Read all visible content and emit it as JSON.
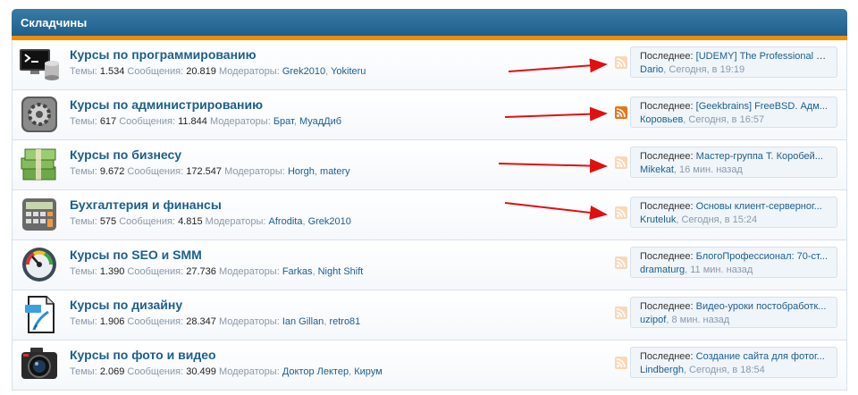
{
  "section": {
    "title": "Складчины"
  },
  "labels": {
    "topics": "Темы:",
    "messages": "Сообщения:",
    "moderators": "Модераторы:",
    "last": "Последнее:"
  },
  "nodes": [
    {
      "title": "Курсы по программированию",
      "icon": "terminal-icon",
      "topics": "1.534",
      "messages": "20.819",
      "mods": [
        "Grek2010",
        "Yokiteru"
      ],
      "last_thread": "[UDEMY] The Professional R...",
      "last_user": "Dario",
      "last_time": ", Сегодня, в 19:19",
      "rss_active": false
    },
    {
      "title": "Курсы по администрированию",
      "icon": "gear-icon",
      "topics": "617",
      "messages": "11.844",
      "mods": [
        "Брат",
        "МуадДиб"
      ],
      "last_thread": "[Geekbrains] FreeBSD. Адм...",
      "last_user": "Коровьев",
      "last_time": ", Сегодня, в 16:57",
      "rss_active": true
    },
    {
      "title": "Курсы по бизнесу",
      "icon": "money-icon",
      "topics": "9.672",
      "messages": "172.547",
      "mods": [
        "Horgh",
        "matery"
      ],
      "last_thread": "Мастер-группа Т. Коробей...",
      "last_user": "Mikekat",
      "last_time": ", 16 мин. назад",
      "rss_active": false
    },
    {
      "title": "Бухгалтерия и финансы",
      "icon": "calculator-icon",
      "topics": "575",
      "messages": "4.815",
      "mods": [
        "Afrodita",
        "Grek2010"
      ],
      "last_thread": "Основы клиент-серверног...",
      "last_user": "Kruteluk",
      "last_time": ", Сегодня, в 15:24",
      "rss_active": false
    },
    {
      "title": "Курсы по SEO и SMM",
      "icon": "gauge-icon",
      "topics": "1.390",
      "messages": "27.736",
      "mods": [
        "Farkas",
        "Night Shift"
      ],
      "last_thread": "БлогоПрофессионал: 70-ст...",
      "last_user": "dramaturg",
      "last_time": ", 11 мин. назад",
      "rss_active": false
    },
    {
      "title": "Курсы по дизайну",
      "icon": "psd-file-icon",
      "topics": "1.906",
      "messages": "28.347",
      "mods": [
        "Ian Gillan",
        "retro81"
      ],
      "last_thread": "Видео-уроки постобработк...",
      "last_user": "uzipof",
      "last_time": ", 8 мин. назад",
      "rss_active": false
    },
    {
      "title": "Курсы по фото и видео",
      "icon": "camera-icon",
      "topics": "2.069",
      "messages": "30.499",
      "mods": [
        "Доктор Лектер",
        "Кирум"
      ],
      "last_thread": "Создание сайта для фотог...",
      "last_user": "Lindbergh",
      "last_time": ", Сегодня, в 18:54",
      "rss_active": false
    }
  ],
  "colors": {
    "accent": "#1c5e8e",
    "header": "#2a6e9a",
    "stripe": "#f08c00",
    "rss": "#f28c28",
    "arrow": "#e01010"
  }
}
